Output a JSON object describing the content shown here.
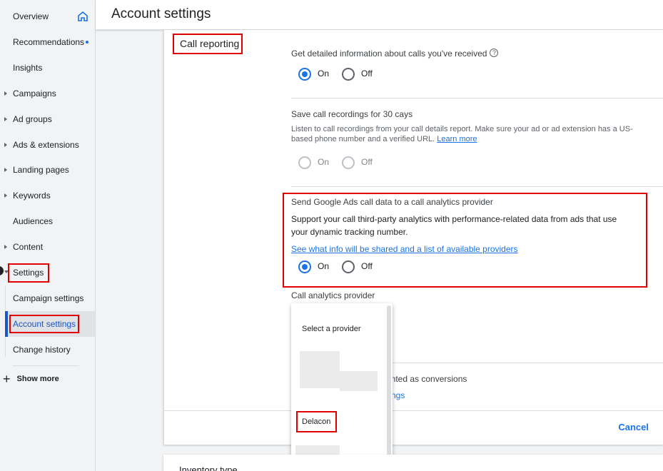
{
  "sidebar": {
    "items": [
      {
        "label": "Overview"
      },
      {
        "label": "Recommendations"
      },
      {
        "label": "Insights"
      },
      {
        "label": "Campaigns"
      },
      {
        "label": "Ad groups"
      },
      {
        "label": "Ads & extensions"
      },
      {
        "label": "Landing pages"
      },
      {
        "label": "Keywords"
      },
      {
        "label": "Audiences"
      },
      {
        "label": "Content"
      },
      {
        "label": "Settings"
      }
    ],
    "sub_items": [
      {
        "label": "Campaign settings"
      },
      {
        "label": "Account settings"
      },
      {
        "label": "Change history"
      }
    ],
    "show_more": "Show more"
  },
  "header": {
    "title": "Account settings"
  },
  "call_reporting": {
    "title": "Call reporting",
    "detail_question": "Get detailed information about calls you've received",
    "on_label": "On",
    "off_label": "Off",
    "recordings_title": "Save call recordings for 30 cays",
    "recordings_desc_1": "Listen to call recordings from your call details report. Make sure your ad or ad extension has a US-",
    "recordings_desc_2": "based phone number and a verified URL.",
    "learn_more": "Learn more",
    "analytics_title": "Send Google Ads call data to a call analytics provider",
    "analytics_desc_1": "Support your call third-party analytics with performance-related data from ads that use",
    "analytics_desc_2": "your dynamic tracking number.",
    "analytics_link": "See what info will be shared and a list of available providers",
    "provider_label": "Call analytics provider",
    "conversions_partial": "unted as conversions",
    "settings_partial": "ngs",
    "cancel": "Cancel"
  },
  "dropdown": {
    "placeholder": "Select a provider",
    "option_delacon": "Delacon"
  },
  "next_card": {
    "title": "Inventory type"
  }
}
